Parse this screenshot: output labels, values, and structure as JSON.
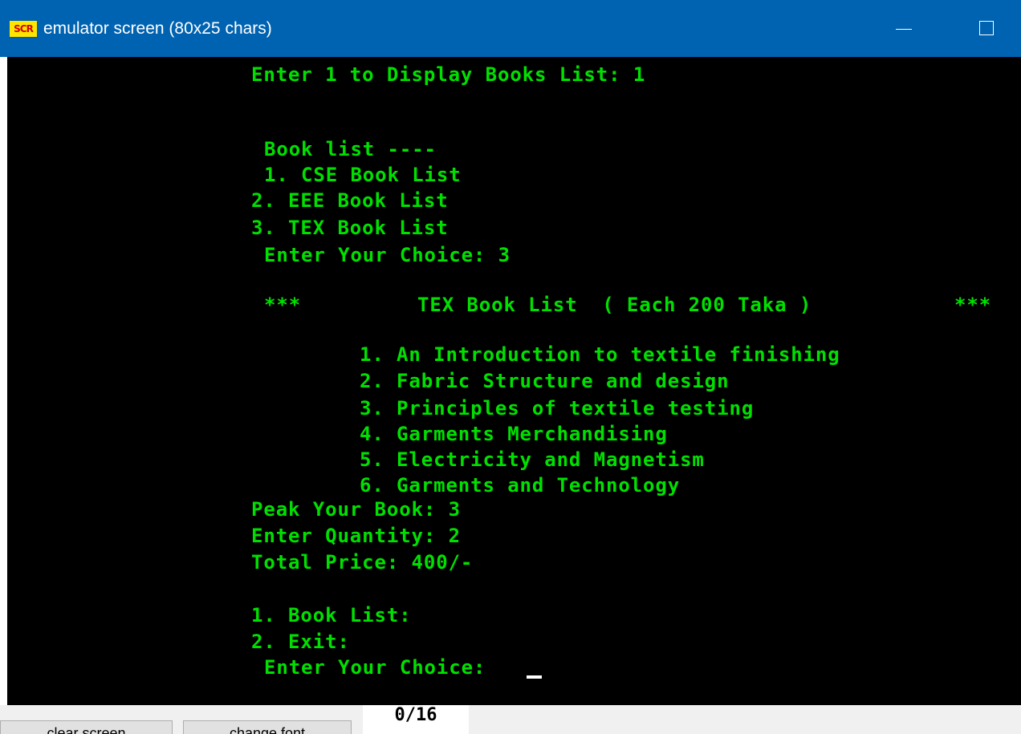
{
  "window": {
    "title": "emulator screen (80x25 chars)",
    "icon_text": "SCR",
    "icon_name": "emulator-app-icon",
    "titlebar_color": "#0063b1"
  },
  "terminal": {
    "text_color": "#00e000",
    "background_color": "#000000",
    "lines": [
      "Enter 1 to Display Books List: 1",
      "Book list ----",
      "1. CSE Book List",
      "2. EEE Book List",
      "3. TEX Book List",
      "Enter Your Choice: 3",
      "***",
      "TEX Book List  ( Each 200 Taka )",
      "***",
      "1. An Introduction to textile finishing",
      "2. Fabric Structure and design",
      "3. Principles of textile testing",
      "4. Garments Merchandising",
      "5. Electricity and Magnetism",
      "6. Garments and Technology",
      "Peak Your Book: 3",
      "Enter Quantity: 2",
      "Total Price: 400/-",
      "1. Book List:",
      "2. Exit:",
      "Enter Your Choice: "
    ]
  },
  "toolbar": {
    "clear_screen_label": "clear screen",
    "change_font_label": "change font",
    "counter": "0/16"
  }
}
